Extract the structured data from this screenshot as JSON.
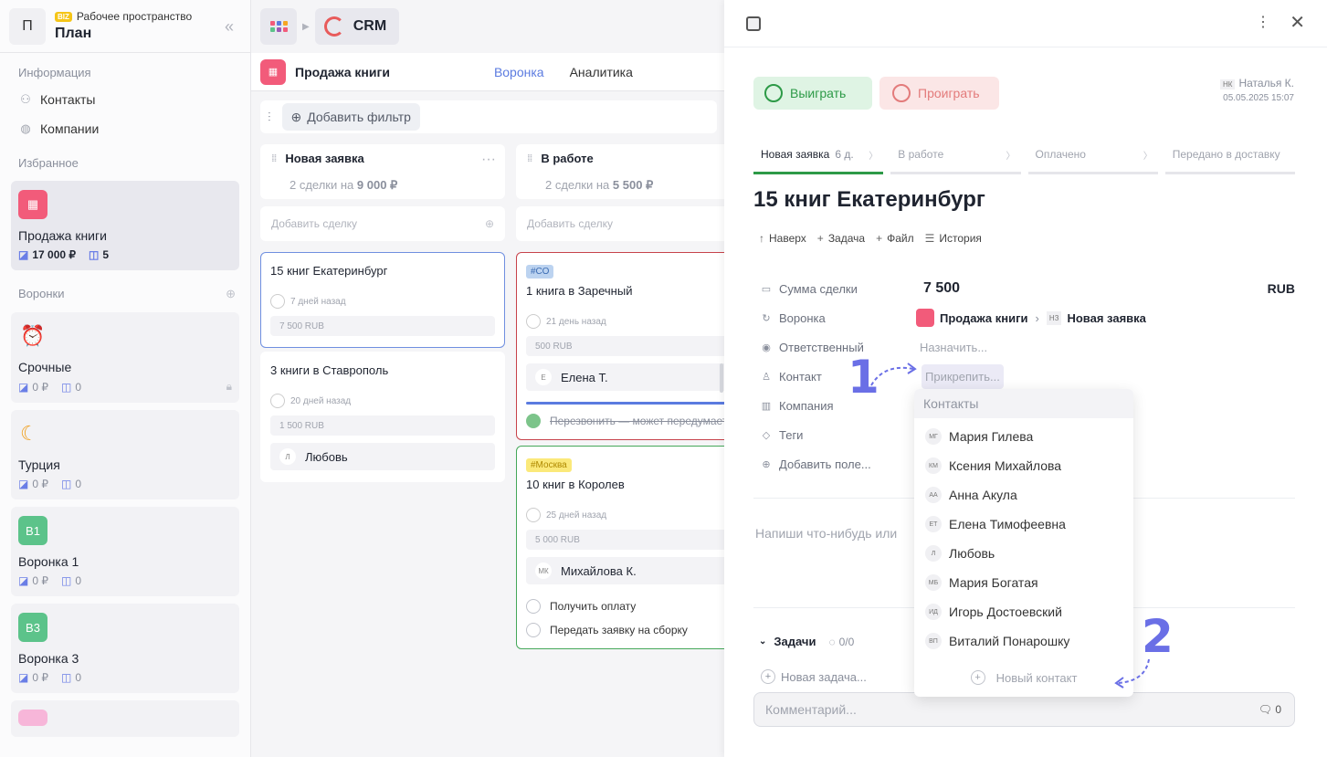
{
  "workspace": {
    "badge": "BIZ",
    "subtitle": "Рабочее пространство",
    "title": "План",
    "avatar_letter": "П"
  },
  "sidebar": {
    "info_label": "Информация",
    "info_items": [
      {
        "label": "Контакты",
        "icon": "contacts-icon"
      },
      {
        "label": "Компании",
        "icon": "companies-icon"
      }
    ],
    "favorites_label": "Избранное",
    "favorite": {
      "title": "Продажа книги",
      "amount": "17 000 ₽",
      "count": "5",
      "color": "#f25b7a"
    },
    "funnels_label": "Воронки",
    "funnels": [
      {
        "title": "Срочные",
        "amount": "0 ₽",
        "count": "0",
        "icon": "alarm-clock-icon",
        "locked": true
      },
      {
        "title": "Турция",
        "amount": "0 ₽",
        "count": "0",
        "icon": "moon-icon"
      },
      {
        "title": "Воронка 1",
        "amount": "0 ₽",
        "count": "0",
        "badge": "В1",
        "color": "#5cc38a"
      },
      {
        "title": "Воронка 3",
        "amount": "0 ₽",
        "count": "0",
        "badge": "В3",
        "color": "#5cc38a"
      }
    ]
  },
  "topbar": {
    "app": "CRM"
  },
  "board": {
    "title": "Продажа книги",
    "tabs": [
      "Воронка",
      "Аналитика"
    ],
    "add_filter": "Добавить фильтр",
    "add_deal": "Добавить сделку",
    "columns": [
      {
        "title": "Новая заявка",
        "summary_prefix": "2 сделки на",
        "summary_amount": "9 000 ₽"
      },
      {
        "title": "В работе",
        "summary_prefix": "2 сделки на",
        "summary_amount": "5 500 ₽"
      }
    ],
    "deals": {
      "d1": {
        "title": "15 книг Екатеринбург",
        "time": "7 дней назад",
        "amount": "7 500 RUB"
      },
      "d2": {
        "title": "3 книги в Ставрополь",
        "time": "20 дней назад",
        "amount": "1 500 RUB",
        "person": "Любовь",
        "person_initial": "Л"
      },
      "d3": {
        "tag": "#СО",
        "title": "1 книга в Заречный",
        "time": "21 день назад",
        "amount": "500 RUB",
        "person": "Елена Т.",
        "person_initial": "Е",
        "task": "Перезвонить — может передумает"
      },
      "d4": {
        "tag": "#Москва",
        "title": "10 книг в Королев",
        "time": "25 дней назад",
        "amount": "5 000 RUB",
        "person": "Михайлова К.",
        "person_initial": "МК",
        "tasks": [
          "Получить оплату",
          "Передать заявку на сборку"
        ]
      }
    }
  },
  "panel": {
    "win": "Выиграть",
    "lose": "Проиграть",
    "author_initials": "НК",
    "author": "Наталья К.",
    "date": "05.05.2025 15:07",
    "stages": [
      {
        "label": "Новая заявка",
        "days": "6 д."
      },
      {
        "label": "В работе"
      },
      {
        "label": "Оплачено"
      },
      {
        "label": "Передано в доставку"
      }
    ],
    "title": "15 книг Екатеринбург",
    "actions": [
      "Наверх",
      "Задача",
      "Файл",
      "История"
    ],
    "fields": {
      "sum_label": "Сумма сделки",
      "sum_value": "7 500",
      "currency": "RUB",
      "funnel_label": "Воронка",
      "funnel_value": "Продажа книги",
      "stage_initials": "НЗ",
      "stage_value": "Новая заявка",
      "owner_label": "Ответственный",
      "owner_value": "Назначить...",
      "contact_label": "Контакт",
      "contact_value": "Прикрепить...",
      "company_label": "Компания",
      "tags_label": "Теги",
      "add_field": "Добавить поле..."
    },
    "note_placeholder": "Напиши что-нибудь или",
    "tasks_label": "Задачи",
    "tasks_count": "0/0",
    "new_task": "Новая задача...",
    "comment_placeholder": "Комментарий...",
    "comment_count": "0"
  },
  "dropdown": {
    "search_placeholder": "Контакты",
    "items": [
      {
        "initials": "МГ",
        "name": "Мария Гилева"
      },
      {
        "initials": "КМ",
        "name": "Ксения Михайлова"
      },
      {
        "initials": "АА",
        "name": "Анна Акула"
      },
      {
        "initials": "ЕТ",
        "name": "Елена Тимофеевна"
      },
      {
        "initials": "Л",
        "name": "Любовь"
      },
      {
        "initials": "МБ",
        "name": "Мария Богатая"
      },
      {
        "initials": "ИД",
        "name": "Игорь Достоевский"
      },
      {
        "initials": "ВП",
        "name": "Виталий Понарошку"
      }
    ],
    "new_contact": "Новый контакт"
  },
  "annotations": [
    "1",
    "2"
  ],
  "colors": {
    "accent": "#5b7be0",
    "win": "#2d9a47",
    "lose": "#e37b7b",
    "brand_pink": "#f25b7a"
  }
}
